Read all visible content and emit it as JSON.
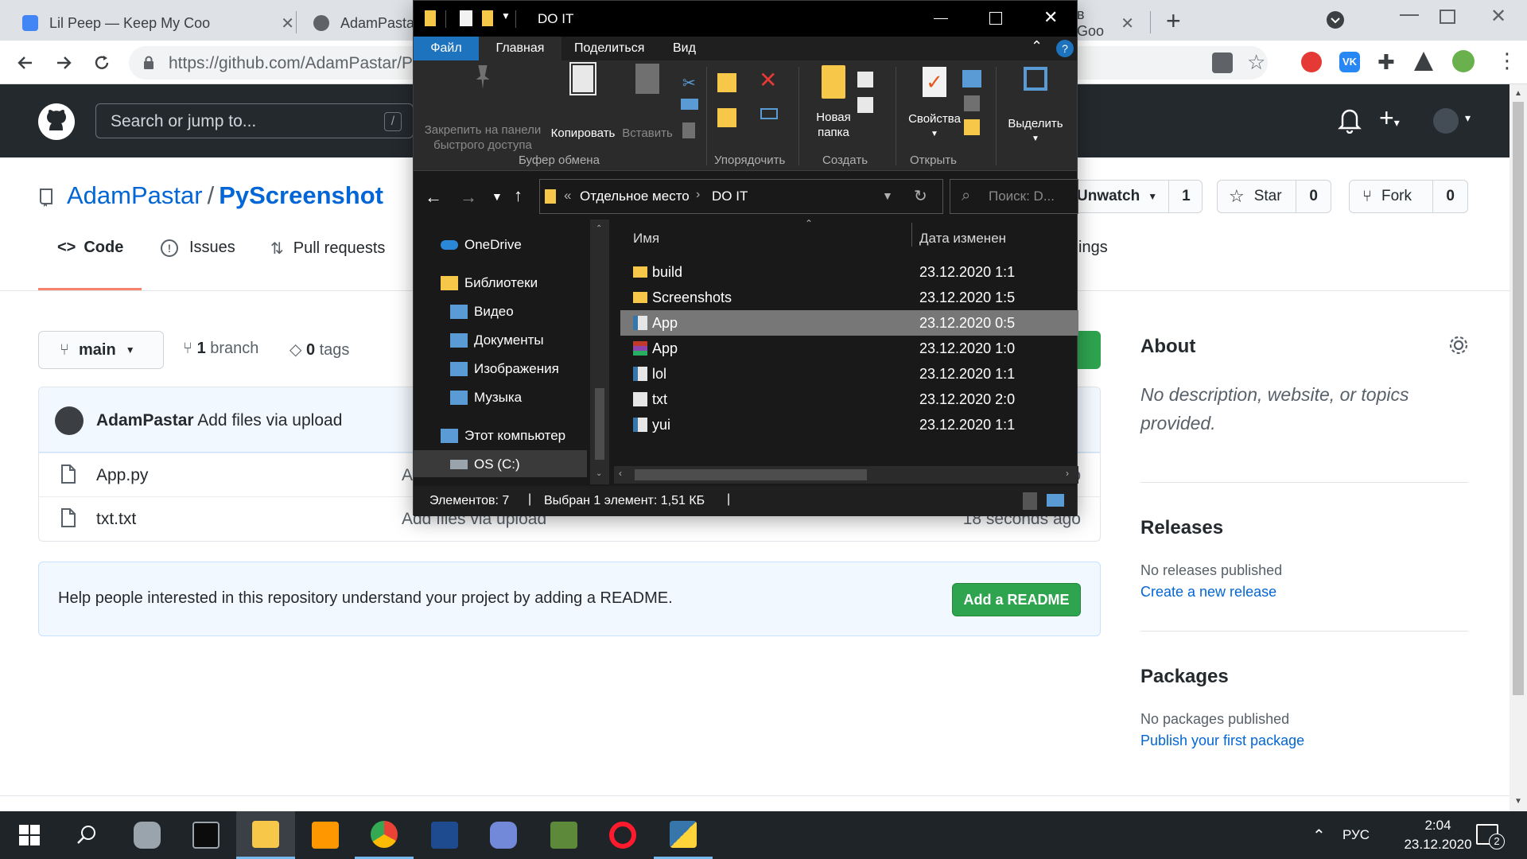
{
  "browser": {
    "tabs": [
      {
        "title": "Lil Peep — Keep My Coo",
        "close": "✕"
      },
      {
        "title": "AdamPastar",
        "close": "✕"
      },
      {
        "title": "в Goo",
        "close": "✕"
      }
    ],
    "new_tab": "+",
    "url": "https://github.com/AdamPastar/P",
    "colors": {
      "tabstrip": "#dee1e6",
      "accent": "#1a73e8"
    }
  },
  "github": {
    "search_placeholder": "Search or jump to...",
    "search_key": "/",
    "owner": "AdamPastar",
    "separator": "/",
    "repo": "PyScreenshot",
    "tabs": [
      "Code",
      "Issues",
      "Pull requests",
      "ings"
    ],
    "unwatch": {
      "label": "Unwatch",
      "count": "1"
    },
    "star": {
      "label": "Star",
      "count": "0"
    },
    "fork": {
      "label": "Fork",
      "count": "0"
    },
    "branch_selector": "main",
    "branches": {
      "count": "1",
      "label": "branch"
    },
    "tags": {
      "count": "0",
      "label": "tags"
    },
    "commit": {
      "author": "AdamPastar",
      "message": "Add files via upload"
    },
    "files": [
      {
        "name": "App.py",
        "message": "A",
        "age": "o"
      },
      {
        "name": "txt.txt",
        "message": "Add files via upload",
        "age": "18 seconds ago"
      }
    ],
    "readme_prompt": "Help people interested in this repository understand your project by adding a README.",
    "add_readme": "Add a README",
    "sidebar": {
      "about_title": "About",
      "about_text": "No description, website, or topics provided.",
      "releases_title": "Releases",
      "releases_text": "No releases published",
      "releases_link": "Create a new release",
      "packages_title": "Packages",
      "packages_text": "No packages published",
      "packages_link": "Publish your first package"
    },
    "colors": {
      "header": "#24292e",
      "link": "#0366d6",
      "green": "#2ea44f",
      "tab_underline": "#f9826c"
    }
  },
  "explorer": {
    "title": "DO IT",
    "menu": [
      "Файл",
      "Главная",
      "Поделиться",
      "Вид"
    ],
    "ribbon": {
      "pin": "Закрепить на панели быстрого доступа",
      "copy": "Копировать",
      "paste": "Вставить",
      "new_folder": "Новая папка",
      "properties": "Свойства",
      "select": "Выделить",
      "groups": [
        "Буфер обмена",
        "Упорядочить",
        "Создать",
        "Открыть"
      ]
    },
    "address": {
      "prefix": "«",
      "segments": [
        "Отдельное место",
        "DO IT"
      ]
    },
    "search_placeholder": "Поиск: D...",
    "nav": [
      {
        "label": "OneDrive",
        "icon": "cloud-icon"
      },
      {
        "label": "Библиотеки",
        "icon": "library-icon"
      },
      {
        "label": "Видео",
        "icon": "video-icon"
      },
      {
        "label": "Документы",
        "icon": "documents-icon"
      },
      {
        "label": "Изображения",
        "icon": "images-icon"
      },
      {
        "label": "Музыка",
        "icon": "music-icon"
      },
      {
        "label": "Этот компьютер",
        "icon": "computer-icon"
      },
      {
        "label": "OS (C:)",
        "icon": "drive-icon"
      }
    ],
    "columns": {
      "name": "Имя",
      "date": "Дата изменен"
    },
    "files": [
      {
        "name": "build",
        "date": "23.12.2020 1:1",
        "type": "folder"
      },
      {
        "name": "Screenshots",
        "date": "23.12.2020 1:5",
        "type": "folder"
      },
      {
        "name": "App",
        "date": "23.12.2020 0:5",
        "type": "python",
        "selected": true
      },
      {
        "name": "App",
        "date": "23.12.2020 1:0",
        "type": "archive"
      },
      {
        "name": "lol",
        "date": "23.12.2020 1:1",
        "type": "python"
      },
      {
        "name": "txt",
        "date": "23.12.2020 2:0",
        "type": "text"
      },
      {
        "name": "yui",
        "date": "23.12.2020 1:1",
        "type": "python"
      }
    ],
    "status_count": "Элементов: 7",
    "status_selected": "Выбран 1 элемент: 1,51 КБ",
    "colors": {
      "background": "#191919",
      "accent": "#1e73be",
      "selected_row": "#777777"
    }
  },
  "taskbar": {
    "language": "РУС",
    "time": "2:04",
    "date": "23.12.2020",
    "notifications": "2",
    "apps": [
      "start-icon",
      "search-icon",
      "storage-icon",
      "terminal-icon",
      "explorer-icon",
      "sublime-icon",
      "chrome-icon",
      "devcpp-icon",
      "discord-icon",
      "minecraft-icon",
      "opera-icon",
      "python-icon"
    ]
  }
}
